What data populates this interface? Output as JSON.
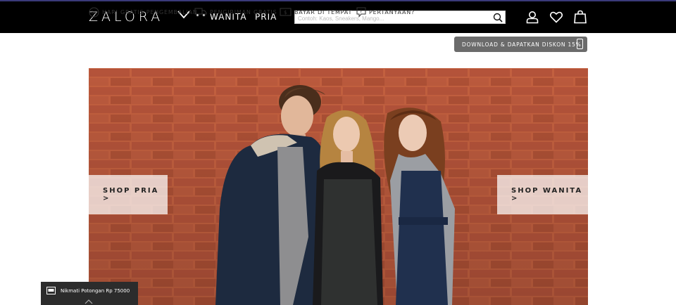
{
  "header": {
    "logo": "ZALORA",
    "nav": [
      "WANITA",
      "PRIA"
    ],
    "search_placeholder": "Contoh: Kaos, Sneakers, Mango..."
  },
  "infobar": {
    "items": [
      {
        "icon": "30-days-return-icon",
        "label": "HARI GRATIS PENGEMBALIAN"
      },
      {
        "icon": "truck-icon",
        "label": "PENGIRIMAN GRATIS"
      },
      {
        "icon": "cash-icon",
        "label": "BAYAR DI TEMPAT"
      },
      {
        "icon": "question-icon",
        "label": "PERTANYAAN?"
      }
    ],
    "download": "DOWNLOAD & DAPATKAN DISKON 15%"
  },
  "hero": {
    "cta_left": "SHOP PRIA >",
    "cta_right": "SHOP WANITA >"
  },
  "promo": {
    "text": "Nikmati Potongan Rp 75000"
  },
  "colors": {
    "topbar": "#000000",
    "brick": "#b5593b",
    "download_btn": "#6b6b6b",
    "promo_bg": "#2c2c2c"
  }
}
